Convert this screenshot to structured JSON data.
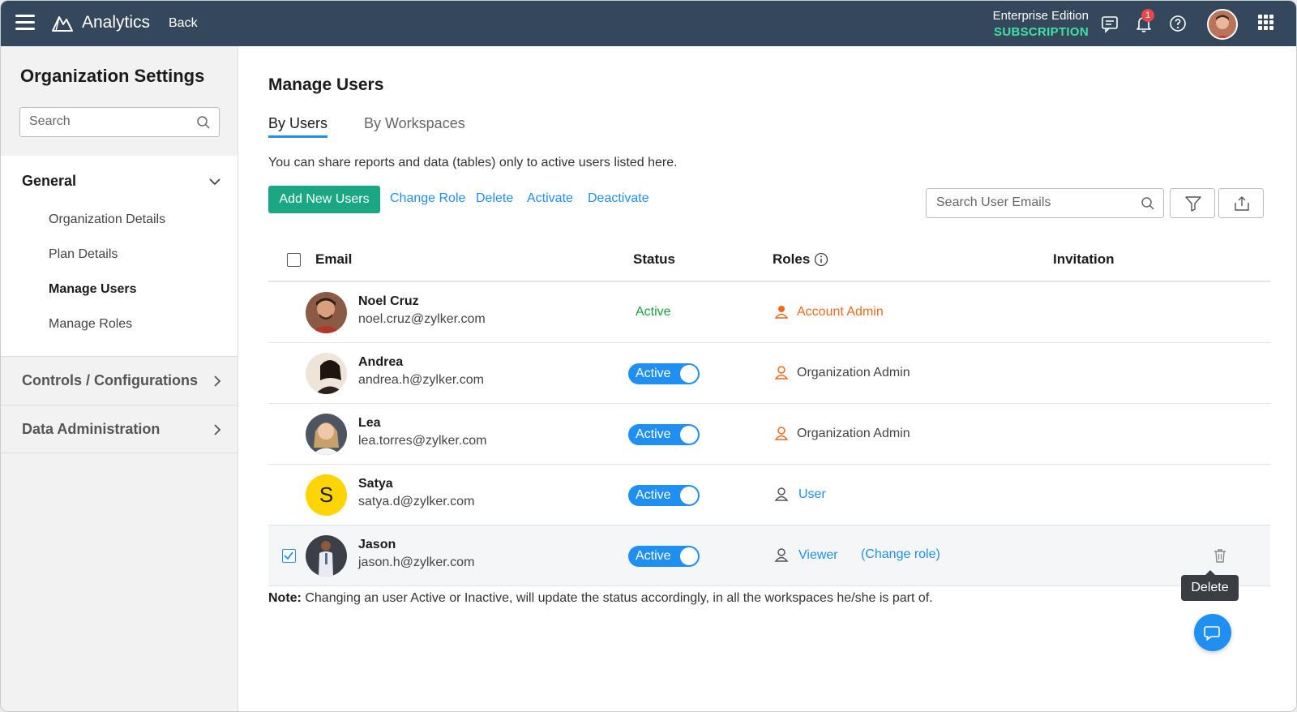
{
  "topbar": {
    "app_title": "Analytics",
    "back_label": "Back",
    "edition_name": "Enterprise Edition",
    "edition_sub": "SUBSCRIPTION",
    "notification_count": "1"
  },
  "sidebar": {
    "title": "Organization Settings",
    "search_placeholder": "Search",
    "general_label": "General",
    "general_items": [
      "Organization Details",
      "Plan Details",
      "Manage Users",
      "Manage Roles"
    ],
    "active_item": "Manage Users",
    "sections": [
      "Controls / Configurations",
      "Data Administration"
    ]
  },
  "main": {
    "title": "Manage Users",
    "tabs": [
      "By Users",
      "By Workspaces"
    ],
    "active_tab": "By Users",
    "info_text": "You can share reports and data (tables) only to active users listed here.",
    "add_button": "Add New Users",
    "actions": [
      "Change Role",
      "Delete",
      "Activate",
      "Deactivate"
    ],
    "email_search_placeholder": "Search User Emails",
    "columns": [
      "Email",
      "Status",
      "Roles",
      "Invitation"
    ],
    "users": [
      {
        "name": "Noel Cruz",
        "email": "noel.cruz@zylker.com",
        "status": "Active",
        "role": "Account Admin",
        "checked": false
      },
      {
        "name": "Andrea",
        "email": "andrea.h@zylker.com",
        "status": "Active",
        "role": "Organization Admin",
        "checked": false
      },
      {
        "name": "Lea",
        "email": "lea.torres@zylker.com",
        "status": "Active",
        "role": "Organization Admin",
        "checked": false
      },
      {
        "name": "Satya",
        "email": "satya.d@zylker.com",
        "status": "Active",
        "role": "User",
        "checked": false,
        "initial": "S"
      },
      {
        "name": "Jason",
        "email": "jason.h@zylker.com",
        "status": "Active",
        "role": "Viewer",
        "checked": true
      }
    ],
    "change_role_link": "(Change role)",
    "note_label": "Note:",
    "note_text": " Changing an user Active or Inactive, will update the status accordingly, in all the workspaces he/she is part of.",
    "tooltip": "Delete"
  },
  "colors": {
    "topbar": "#34475b",
    "accent_blue": "#1f8ff2",
    "accent_green": "#1aa884",
    "subscription": "#3fe0a3",
    "admin_orange": "#ee6a1e",
    "satya_avatar": "#ffd400"
  }
}
